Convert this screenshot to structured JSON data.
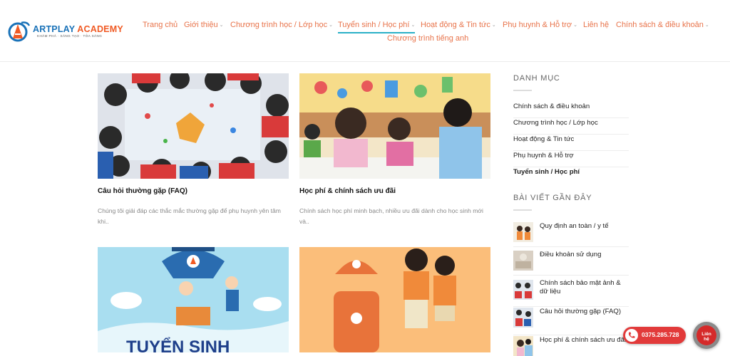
{
  "brand": {
    "logo_text_main": "ARTPLAY ",
    "logo_text_accent": "ACADEMY",
    "tagline": "KHÁM PHÁ · SÁNG TẠO · TỎA SÁNG"
  },
  "nav": {
    "home": "Trang chủ",
    "about": "Giới thiệu",
    "programs": "Chương trình học / Lớp học",
    "admissions": "Tuyển sinh / Học phí",
    "news": "Hoạt động & Tin tức",
    "parents": "Phụ huynh & Hỗ trợ",
    "contact": "Liên hệ",
    "policies": "Chính sách & điều khoản",
    "english": "Chương trình tiếng anh"
  },
  "posts": [
    {
      "title": "Câu hỏi thường gặp (FAQ)",
      "excerpt": "Chúng tôi giải đáp các thắc mắc thường gặp để phụ huynh yên tâm khi.."
    },
    {
      "title": "Học phí & chính sách ưu đãi",
      "excerpt": "Chính sách học phí minh bạch, nhiều ưu đãi dành cho học sinh mới và.."
    },
    {
      "poster_text": "TUYỂN SINH"
    },
    {}
  ],
  "sidebar": {
    "categories_heading": "DANH MỤC",
    "categories": [
      "Chính sách & điều khoản",
      "Chương trình học / Lớp học",
      "Hoạt động & Tin tức",
      "Phụ huynh & Hỗ trợ",
      "Tuyển sinh / Học phí"
    ],
    "recent_heading": "BÀI VIẾT GẦN ĐÂY",
    "recent": [
      "Quy định an toàn / y tế",
      "Điều khoản sử dụng",
      "Chính sách bảo mật ảnh & dữ liệu",
      "Câu hỏi thường gặp (FAQ)",
      "Học phí & chính sách ưu đãi"
    ]
  },
  "floating": {
    "hotline": "0375.285.728",
    "contact_label_line1": "Liên",
    "contact_label_line2": "hệ"
  },
  "colors": {
    "nav_text": "#e8734a",
    "active_underline": "#2ab0c7",
    "hotline_bg": "#e23a3a"
  }
}
